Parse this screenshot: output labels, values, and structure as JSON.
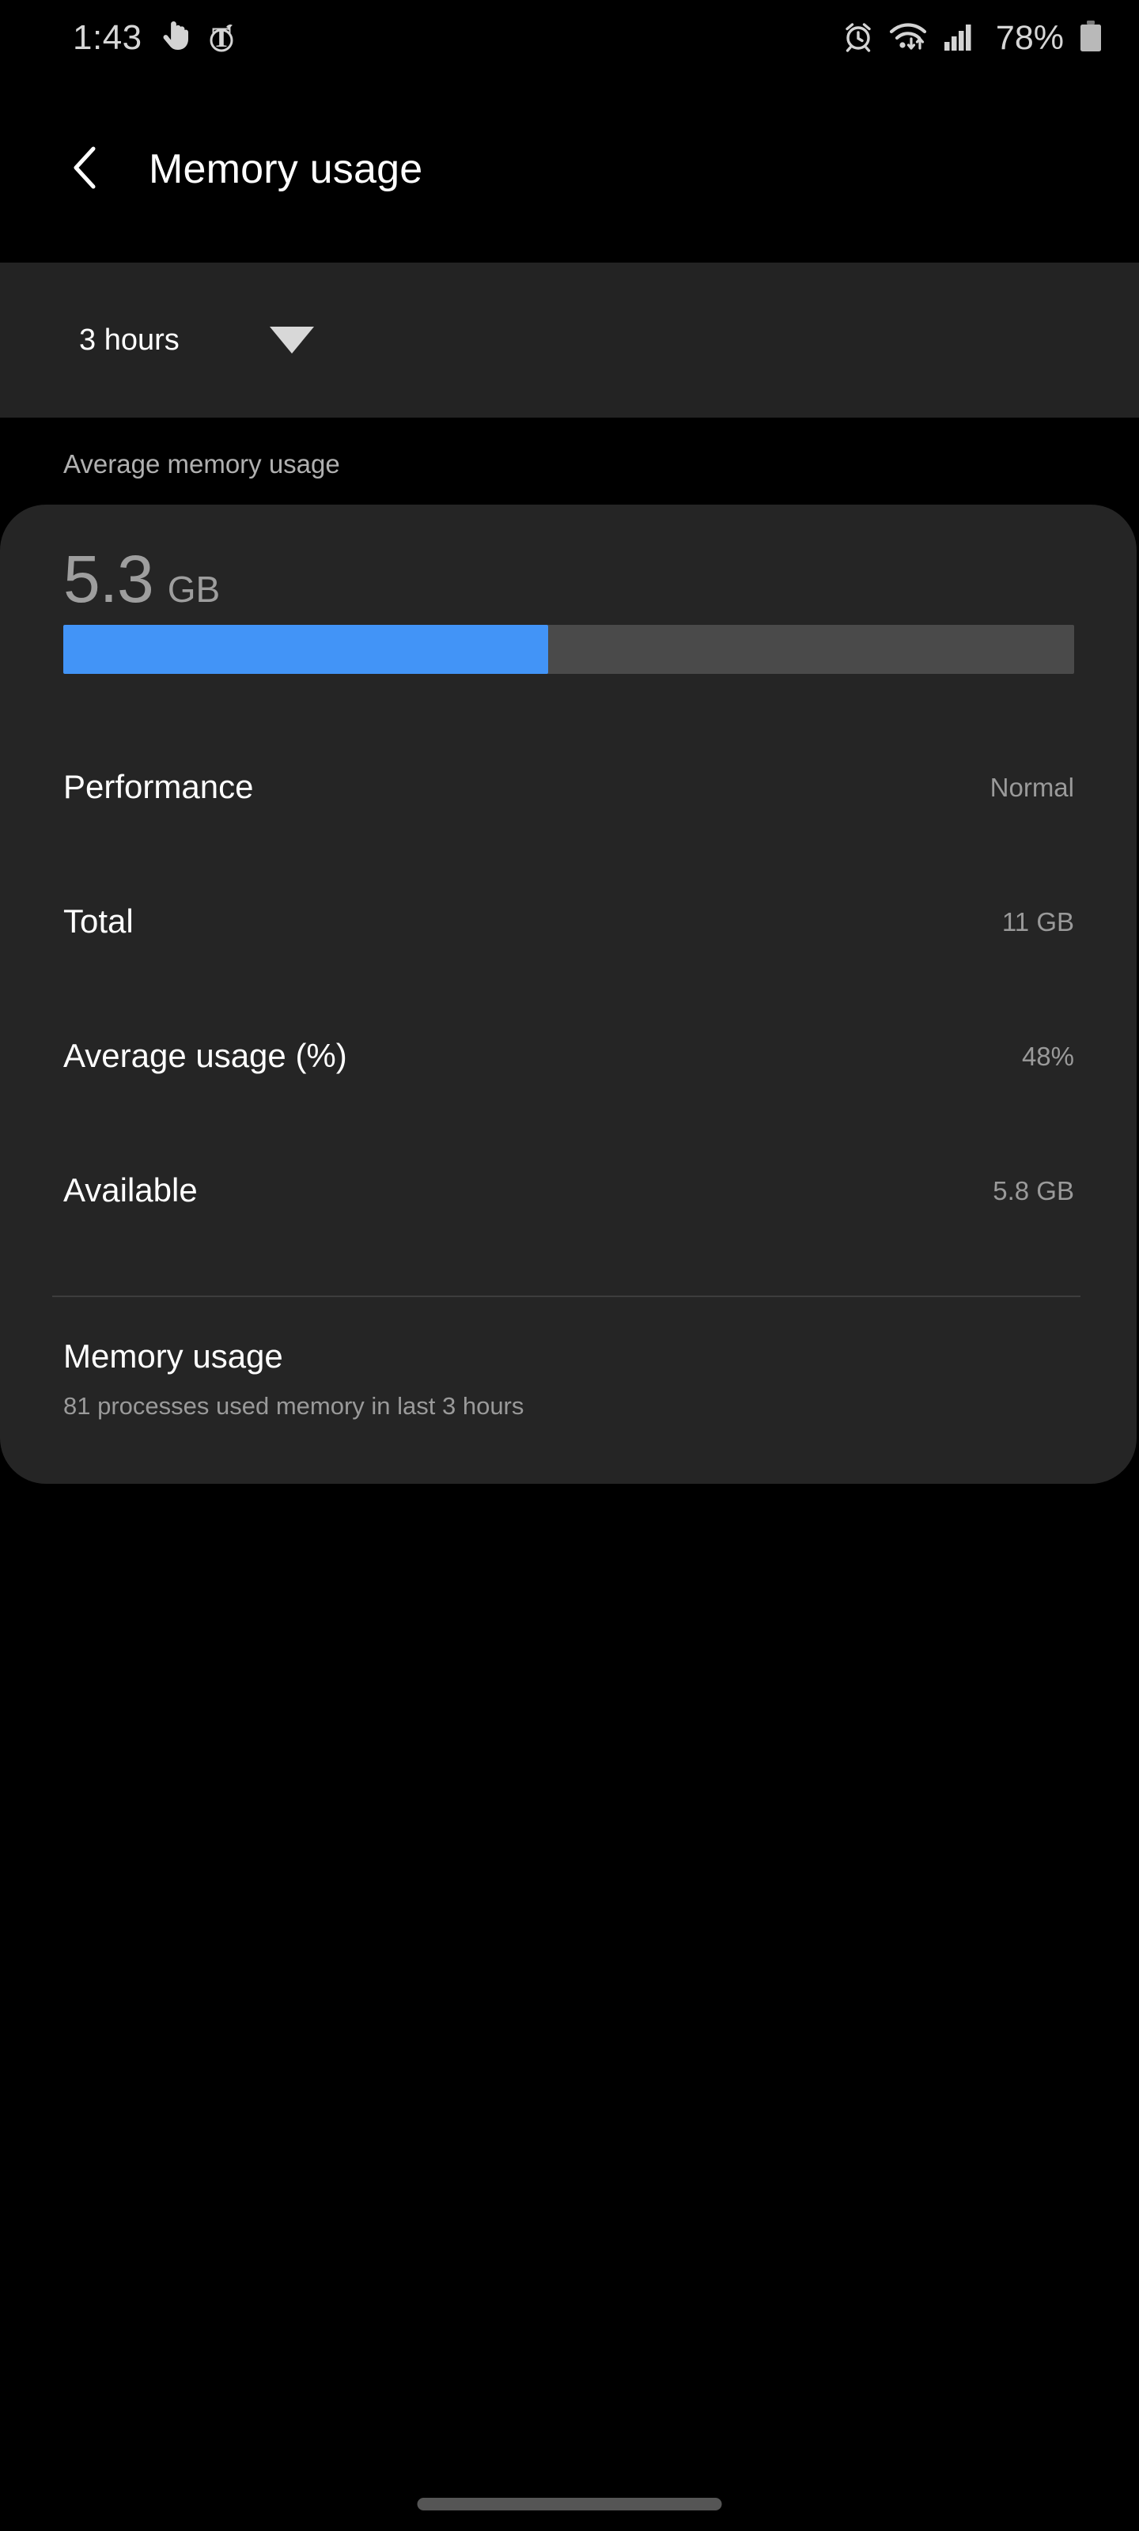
{
  "status_bar": {
    "time": "1:43",
    "battery_percent": "78%",
    "notification_icons": [
      "touch-hand-icon",
      "new-york-times-icon"
    ],
    "system_icons": [
      "alarm-icon",
      "wifi-icon",
      "cellular-signal-icon",
      "battery-icon"
    ]
  },
  "app_bar": {
    "back_icon": "back-chevron-icon",
    "title": "Memory usage"
  },
  "period_selector": {
    "value": "3 hours",
    "caret_icon": "chevron-down-icon"
  },
  "section": {
    "label": "Average memory usage"
  },
  "summary": {
    "value": "5.3",
    "unit": "GB",
    "progress_percent": 48,
    "fill_color": "#4294f7",
    "track_color": "#4a4a4a"
  },
  "details": [
    {
      "key": "Performance",
      "value": "Normal"
    },
    {
      "key": "Total",
      "value": "11 GB"
    },
    {
      "key": "Average usage (%)",
      "value": "48%"
    },
    {
      "key": "Available",
      "value": "5.8 GB"
    }
  ],
  "footer": {
    "title": "Memory usage",
    "subtitle": "81 processes used memory in last 3 hours"
  }
}
